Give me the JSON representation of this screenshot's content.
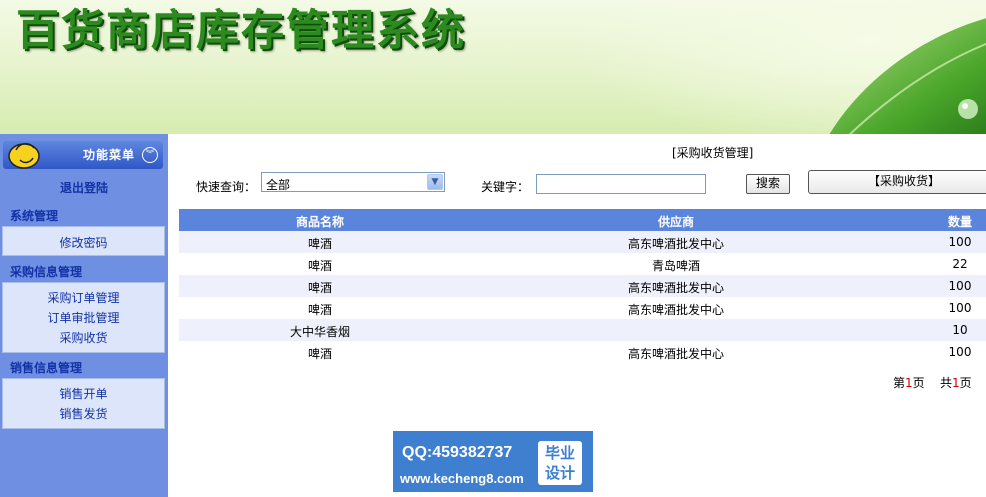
{
  "banner": {
    "title": "百货商店库存管理系统"
  },
  "sidebar": {
    "menu_title": "功能菜单",
    "logout": "退出登陆",
    "sections": [
      {
        "title": "系统管理",
        "items": [
          "修改密码"
        ]
      },
      {
        "title": "采购信息管理",
        "items": [
          "采购订单管理",
          "订单审批管理",
          "采购收货"
        ]
      },
      {
        "title": "销售信息管理",
        "items": [
          "销售开单",
          "销售发货"
        ]
      }
    ]
  },
  "main": {
    "heading": "[采购收货管理]",
    "search": {
      "quick_label": "快速查询：",
      "quick_value": "全部",
      "keyword_label": "关键字：",
      "keyword_value": "",
      "search_button": "搜索",
      "purchase_button": "【采购收货】"
    },
    "table": {
      "headers": [
        "商品名称",
        "供应商",
        "数量"
      ],
      "rows": [
        [
          "啤酒",
          "高东啤酒批发中心",
          "100"
        ],
        [
          "啤酒",
          "青岛啤酒",
          "22"
        ],
        [
          "啤酒",
          "高东啤酒批发中心",
          "100"
        ],
        [
          "啤酒",
          "高东啤酒批发中心",
          "100"
        ],
        [
          "大中华香烟",
          "",
          "10"
        ],
        [
          "啤酒",
          "高东啤酒批发中心",
          "100"
        ]
      ]
    },
    "pager": {
      "page_prefix": "第",
      "page_current": "1",
      "page_suffix": "页",
      "total_prefix": "共",
      "total_pages": "1",
      "total_suffix": "页"
    }
  },
  "watermark": {
    "qq": "QQ:459382737",
    "url": "www.kecheng8.com",
    "badge_line1": "毕业",
    "badge_line2": "设计"
  },
  "colors": {
    "header_blue": "#5b84dc",
    "sidebar_blue": "#6f90e2",
    "banner_green": "#2d8a1f"
  }
}
